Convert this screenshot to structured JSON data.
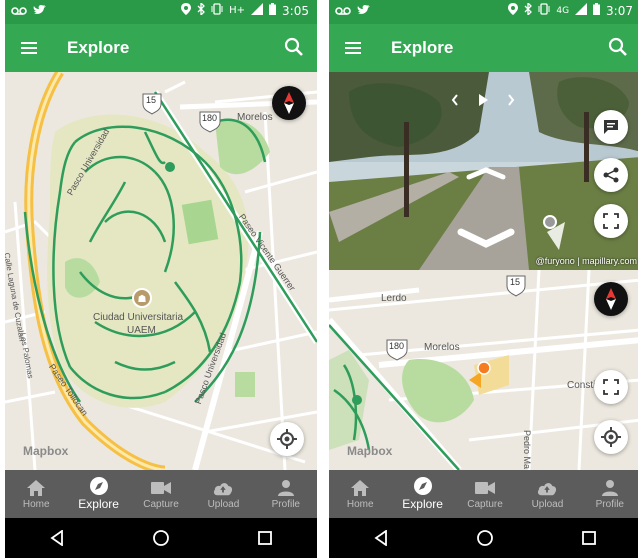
{
  "status_left": {
    "time": "3:05",
    "network": "H+"
  },
  "status_right": {
    "time": "3:07",
    "network": "4G"
  },
  "appbar": {
    "title": "Explore"
  },
  "nav": [
    {
      "label": "Home",
      "icon": "home-icon"
    },
    {
      "label": "Explore",
      "icon": "explore-icon"
    },
    {
      "label": "Capture",
      "icon": "video-camera-icon"
    },
    {
      "label": "Upload",
      "icon": "cloud-upload-icon"
    },
    {
      "label": "Profile",
      "icon": "person-icon"
    }
  ],
  "map_left": {
    "labels": {
      "pasco_universidad": "Pasco Universidad",
      "paseo_vicente": "Paseo Vicente Guerrer",
      "ciudad": "Ciudad Universitaria",
      "unam": "UAEM",
      "pasco_universidad2": "Pasco Universidad",
      "calle_laguna": "Calle Laguna de Cuzalan",
      "paseo_tollocan": "Paseo Tollocan",
      "las_palomas": "Los Palomas",
      "morelos": "Morelos",
      "shield_15": "15",
      "shield_180": "180",
      "mapbox": "Mapbox"
    }
  },
  "map_right": {
    "labels": {
      "lerdo": "Lerdo",
      "morelos": "Morelos",
      "shield_15": "15",
      "shield_180": "180",
      "constitucion": "Consti",
      "pedro": "Pedro Ma",
      "mapbox": "Mapbox"
    }
  },
  "street": {
    "attribution": "@furyono | mapillary.com"
  },
  "colors": {
    "primary": "#34a853",
    "status": "#2a9a48",
    "nav_bg": "#5c5c5c",
    "route": "#2e9c5a",
    "highway": "#f5c045"
  }
}
